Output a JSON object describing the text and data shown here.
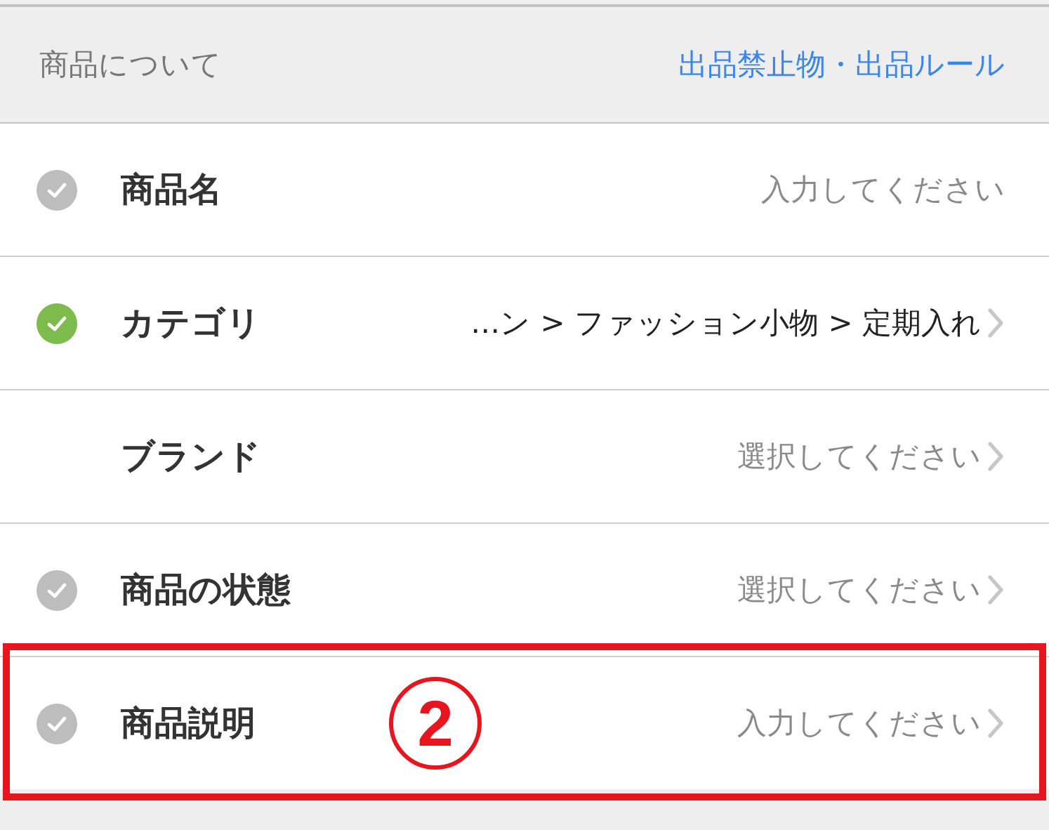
{
  "section_header": {
    "title": "商品について",
    "link": "出品禁止物・出品ルール"
  },
  "rows": [
    {
      "label": "商品名",
      "required": true,
      "checked": false,
      "placeholder": "入力してください",
      "chevron": false,
      "highlighted": false
    },
    {
      "label": "カテゴリ",
      "required": true,
      "checked": true,
      "value": "…ン > ファッション小物 > 定期入れ",
      "chevron": true,
      "highlighted": false
    },
    {
      "label": "ブランド",
      "required": false,
      "placeholder": "選択してください",
      "chevron": true,
      "highlighted": false
    },
    {
      "label": "商品の状態",
      "required": true,
      "checked": false,
      "placeholder": "選択してください",
      "chevron": true,
      "highlighted": false
    },
    {
      "label": "商品説明",
      "required": true,
      "checked": false,
      "placeholder": "入力してください",
      "chevron": true,
      "highlighted": true,
      "badge": "2"
    }
  ]
}
